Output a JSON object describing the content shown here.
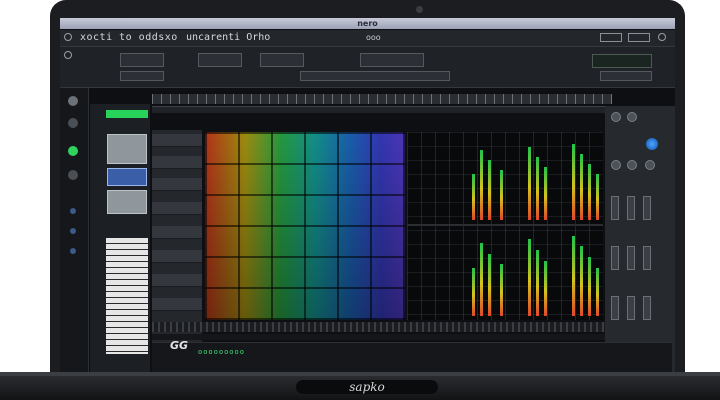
{
  "window": {
    "title": "nero"
  },
  "app": {
    "title": "xocti to oddsxo",
    "project": "uncarenti Orho"
  },
  "toolbar": {
    "center_label": "ooo"
  },
  "transport": {
    "cursor_label": "GG",
    "readout": "ooooooooo"
  },
  "device": {
    "brand": "sapko"
  },
  "icons": [
    "camera-icon",
    "close-icon",
    "minimize-icon",
    "zoom-icon",
    "knob-icon",
    "fader-icon"
  ],
  "colors": {
    "accent_green": "#27d35a",
    "accent_blue": "#2f7cf0",
    "panel": "#1f2226"
  }
}
